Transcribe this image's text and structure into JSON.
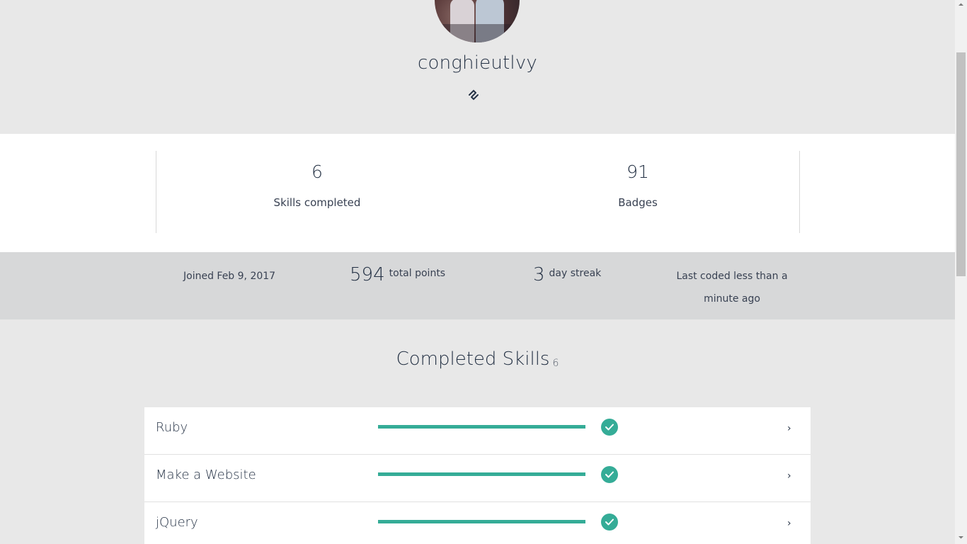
{
  "profile": {
    "username": "conghieutlvy",
    "link_icon": "link-icon",
    "avatar_icon": "profile-photo"
  },
  "stats": {
    "skills_completed": {
      "value": "6",
      "label": "Skills completed"
    },
    "badges": {
      "value": "91",
      "label": "Badges"
    }
  },
  "info": {
    "joined": "Joined Feb 9, 2017",
    "points_value": "594",
    "points_label": "total points",
    "streak_value": "3",
    "streak_label": "day streak",
    "last_coded": "Last coded less than a minute ago"
  },
  "completed_skills": {
    "title": "Completed Skills",
    "count": "6",
    "items": [
      {
        "name": "Ruby",
        "progress": 1.0,
        "status_icon": "check-circle-icon",
        "chevron": "›"
      },
      {
        "name": "Make a Website",
        "progress": 1.0,
        "status_icon": "check-circle-icon",
        "chevron": "›"
      },
      {
        "name": "jQuery",
        "progress": 1.0,
        "status_icon": "check-circle-icon",
        "chevron": "›"
      }
    ]
  },
  "colors": {
    "accent": "#35ac97",
    "text": "#253245",
    "header_bg": "#e8e8e8",
    "info_bg": "#d7d8d9"
  }
}
